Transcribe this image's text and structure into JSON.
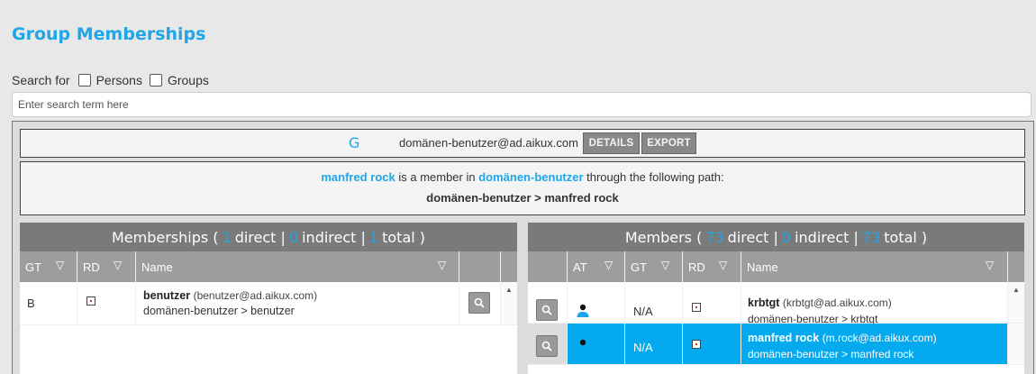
{
  "page": {
    "title": "Group Memberships"
  },
  "search": {
    "label": "Search for",
    "persons_label": "Persons",
    "groups_label": "Groups",
    "placeholder": "Enter search term here"
  },
  "group_bar": {
    "icon_letter": "G",
    "email": "domänen-benutzer@ad.aikux.com",
    "details_label": "DETAILS",
    "export_label": "EXPORT"
  },
  "path_info": {
    "member": "manfred rock",
    "text_mid": " is a member in ",
    "group": "domänen-benutzer",
    "text_end": " through the following path:",
    "path": "domänen-benutzer > manfred rock"
  },
  "memberships": {
    "title_prefix": "Memberships (",
    "direct": "1",
    "direct_label": "direct |",
    "indirect": "0",
    "indirect_label": "indirect |",
    "total": "1",
    "total_label": "total )",
    "columns": [
      "GT",
      "RD",
      "Name"
    ],
    "rows": [
      {
        "gt": "B",
        "name": "benutzer",
        "email": "(benutzer@ad.aikux.com)",
        "path": "domänen-benutzer > benutzer"
      }
    ]
  },
  "members": {
    "title_prefix": "Members (",
    "direct": "73",
    "direct_label": "direct |",
    "indirect": "0",
    "indirect_label": "indirect |",
    "total": "73",
    "total_label": "total )",
    "columns": [
      "AT",
      "GT",
      "RD",
      "Name"
    ],
    "rows": [
      {
        "gt": "N/A",
        "name": "krbtgt",
        "email": "(krbtgt@ad.aikux.com)",
        "path": "domänen-benutzer > krbtgt",
        "selected": false
      },
      {
        "gt": "N/A",
        "name": "manfred rock",
        "email": "(m.rock@ad.aikux.com)",
        "path": "domänen-benutzer > manfred rock",
        "selected": true
      }
    ]
  },
  "colors": {
    "accent": "#1ea6e8",
    "selected_row": "#05a9ed",
    "header_dark": "#7a7a7a",
    "header_light": "#9d9d9d"
  },
  "icons": {
    "filter": "filter-funnel-icon",
    "magnifier": "magnifier-icon",
    "rd": "rd-checkbox-icon",
    "person": "person-icon"
  }
}
